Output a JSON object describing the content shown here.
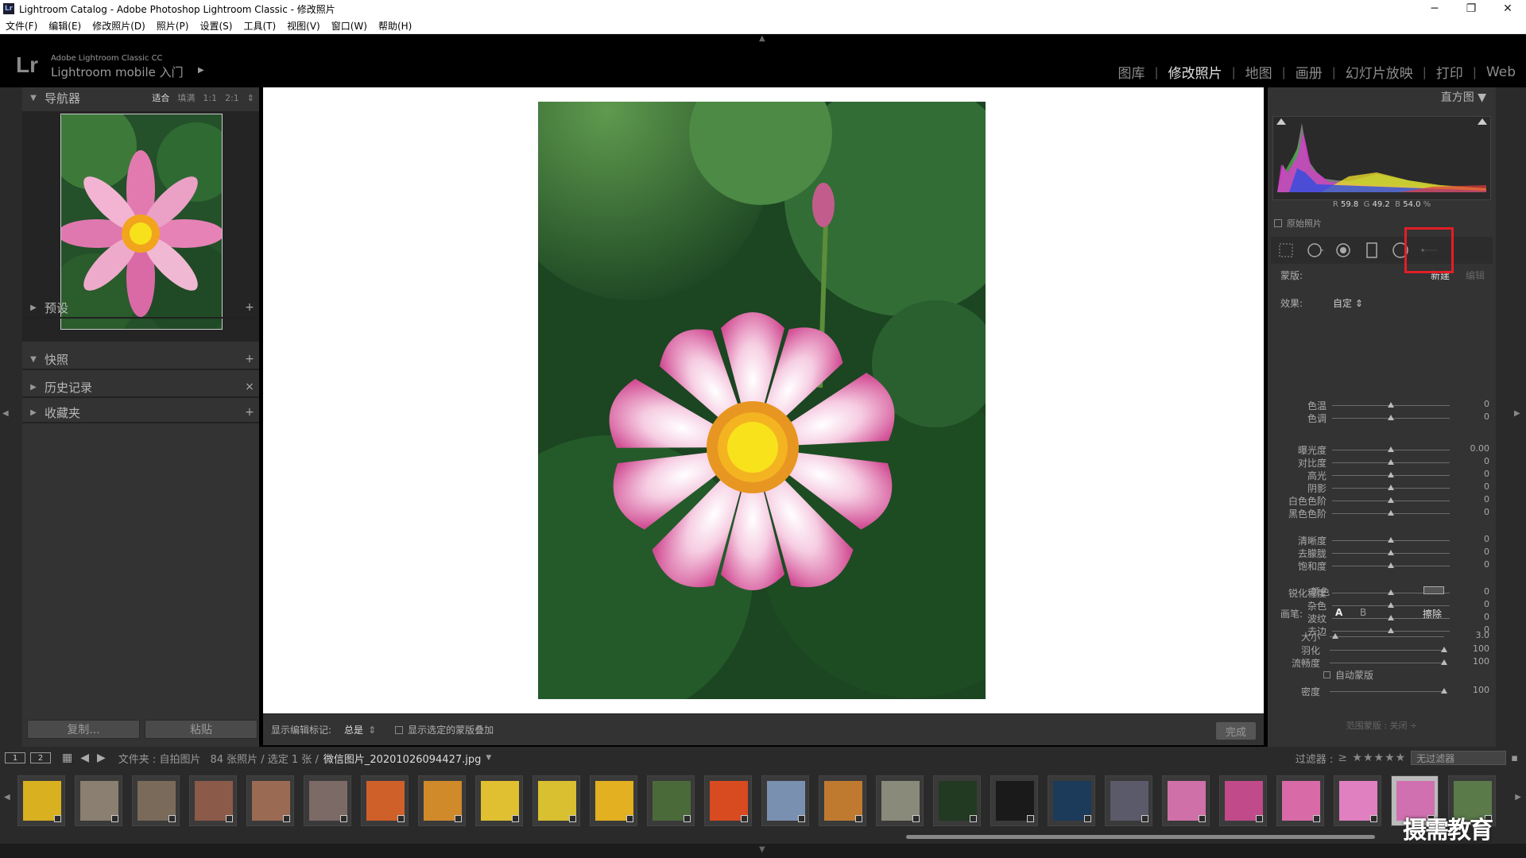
{
  "window": {
    "title": "Lightroom Catalog - Adobe Photoshop Lightroom Classic - 修改照片",
    "app_icon": "Lr"
  },
  "menu": [
    "文件(F)",
    "编辑(E)",
    "修改照片(D)",
    "照片(P)",
    "设置(S)",
    "工具(T)",
    "视图(V)",
    "窗口(W)",
    "帮助(H)"
  ],
  "identity": {
    "logo": "Lr",
    "product": "Adobe Lightroom Classic CC",
    "mobile": "Lightroom mobile 入门"
  },
  "modules": [
    "图库",
    "修改照片",
    "地图",
    "画册",
    "幻灯片放映",
    "打印",
    "Web"
  ],
  "active_module": "修改照片",
  "left": {
    "navigator": {
      "title": "导航器",
      "zoom": [
        "适合",
        "填满",
        "1:1",
        "2:1"
      ],
      "zoom_active": "适合"
    },
    "panels": [
      {
        "title": "预设",
        "action": "+"
      },
      {
        "title": "快照",
        "action": "+"
      },
      {
        "title": "历史记录",
        "action": "×"
      },
      {
        "title": "收藏夹",
        "action": "+"
      }
    ],
    "copy": "复制...",
    "paste": "粘贴"
  },
  "editbar": {
    "show_marks_label": "显示编辑标记:",
    "show_marks_value": "总是",
    "overlay": "显示选定的蒙版叠加",
    "done": "完成"
  },
  "right": {
    "histogram_title": "直方图",
    "rgb": {
      "r_label": "R",
      "r": "59.8",
      "g_label": "G",
      "g": "49.2",
      "b_label": "B",
      "b": "54.0",
      "unit": "%"
    },
    "original": "原始照片",
    "mask_label": "蒙版:",
    "mask_new": "新建",
    "mask_edit": "编辑",
    "effect_label": "效果:",
    "effect_value": "自定",
    "sliders": [
      {
        "label": "色温",
        "value": "0",
        "pos": 0.5
      },
      {
        "label": "色调",
        "value": "0",
        "pos": 0.5
      },
      {
        "label": "曝光度",
        "value": "0.00",
        "pos": 0.5
      },
      {
        "label": "对比度",
        "value": "0",
        "pos": 0.5
      },
      {
        "label": "高光",
        "value": "0",
        "pos": 0.5
      },
      {
        "label": "阴影",
        "value": "0",
        "pos": 0.5
      },
      {
        "label": "白色色阶",
        "value": "0",
        "pos": 0.5
      },
      {
        "label": "黑色色阶",
        "value": "0",
        "pos": 0.5
      },
      {
        "label": "清晰度",
        "value": "0",
        "pos": 0.5
      },
      {
        "label": "去朦胧",
        "value": "0",
        "pos": 0.5
      },
      {
        "label": "饱和度",
        "value": "0",
        "pos": 0.5
      },
      {
        "label": "锐化程度",
        "value": "0",
        "pos": 0.5
      },
      {
        "label": "杂色",
        "value": "0",
        "pos": 0.5
      },
      {
        "label": "波纹",
        "value": "0",
        "pos": 0.5
      },
      {
        "label": "去边",
        "value": "0",
        "pos": 0.5
      }
    ],
    "color_label": "颜色",
    "brush_label": "画笔:",
    "brush_a": "A",
    "brush_b": "B",
    "brush_erase": "擦除",
    "brush_sliders": [
      {
        "label": "大小",
        "value": "3.0",
        "pos": 0.05
      },
      {
        "label": "羽化",
        "value": "100",
        "pos": 1.0
      },
      {
        "label": "流畅度",
        "value": "100",
        "pos": 1.0
      }
    ],
    "auto_mask": "自动蒙版",
    "density": {
      "label": "密度",
      "value": "100",
      "pos": 1.0
    },
    "range_mask": "范围蒙版 : 关闭 ÷"
  },
  "filmstrip": {
    "mon1": "1",
    "mon2": "2",
    "path": "文件夹 : 自拍图片",
    "count": "84 张照片 / 选定 1 张 /",
    "filename": "微信图片_20201026094427.jpg",
    "filter_label": "过滤器 :",
    "filter_value": "无过滤器",
    "thumbnail_count": 26,
    "selected_index": 24
  },
  "watermark": "摄需教育",
  "colors": {
    "accent_red": "#e21e26",
    "panel": "#333333",
    "canvas": "#ffffff"
  }
}
